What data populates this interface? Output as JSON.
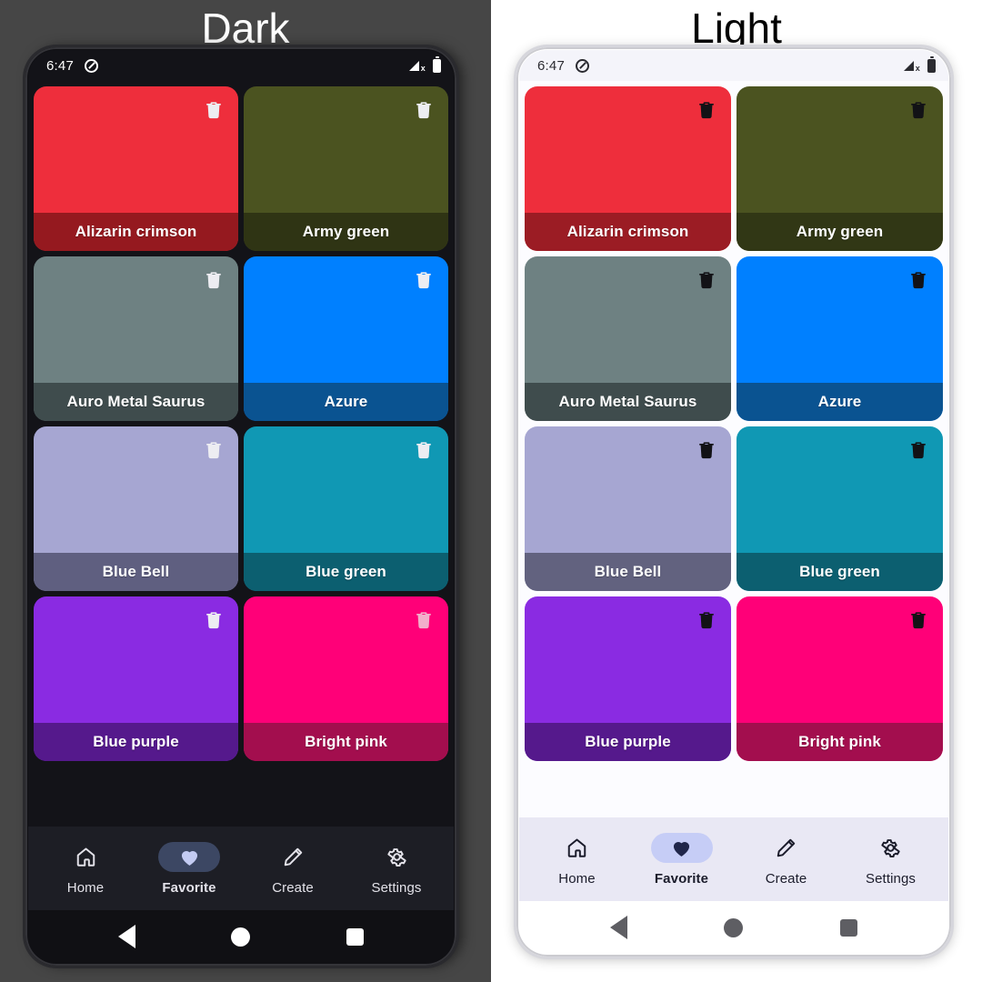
{
  "panels": [
    {
      "title": "Dark",
      "theme": "dark",
      "status_bar": {
        "time": "6:47",
        "dnd_icon": "do-not-disturb-icon",
        "signal_icon": "signal-no-service-icon",
        "battery_icon": "battery-full-icon"
      },
      "cards": [
        {
          "name": "Alizarin crimson",
          "color": "#EE2E3C",
          "footer_color": "#95191F",
          "trash_color": "#EDEDF2"
        },
        {
          "name": "Army green",
          "color": "#4B5320",
          "footer_color": "#2F3414",
          "trash_color": "#EDEDF2"
        },
        {
          "name": "Auro Metal Saurus",
          "color": "#6E8182",
          "footer_color": "#3F4C4D",
          "trash_color": "#EDEDF2"
        },
        {
          "name": "Azure",
          "color": "#0080FF",
          "footer_color": "#0A5391",
          "trash_color": "#EDEDF2"
        },
        {
          "name": "Blue Bell",
          "color": "#A6A6D2",
          "footer_color": "#5F5F80",
          "trash_color": "#EDEDF2"
        },
        {
          "name": "Blue green",
          "color": "#1098B4",
          "footer_color": "#0C5F70",
          "trash_color": "#EDEDF2"
        },
        {
          "name": "Blue purple",
          "color": "#8A2BE2",
          "footer_color": "#55198C",
          "trash_color": "#EDEDF2"
        },
        {
          "name": "Bright pink",
          "color": "#FF0078",
          "footer_color": "#A30E4E",
          "trash_color": "#F2AFCB"
        }
      ],
      "app_nav": [
        {
          "label": "Home",
          "icon": "home-icon",
          "selected": false
        },
        {
          "label": "Favorite",
          "icon": "heart-icon",
          "selected": true
        },
        {
          "label": "Create",
          "icon": "pencil-icon",
          "selected": false
        },
        {
          "label": "Settings",
          "icon": "gear-icon",
          "selected": false
        }
      ],
      "system_nav": [
        {
          "label": "Back",
          "icon": "back-triangle-icon"
        },
        {
          "label": "Home",
          "icon": "home-circle-icon"
        },
        {
          "label": "Recents",
          "icon": "recents-square-icon"
        }
      ]
    },
    {
      "title": "Light",
      "theme": "light",
      "status_bar": {
        "time": "6:47",
        "dnd_icon": "do-not-disturb-icon",
        "signal_icon": "signal-no-service-icon",
        "battery_icon": "battery-full-icon"
      },
      "cards": [
        {
          "name": "Alizarin crimson",
          "color": "#EE2E3C",
          "footer_color": "#9B1C24",
          "trash_color": "#121216"
        },
        {
          "name": "Army green",
          "color": "#4B5320",
          "footer_color": "#313715",
          "trash_color": "#121216"
        },
        {
          "name": "Auro Metal Saurus",
          "color": "#6E8182",
          "footer_color": "#3F4C4D",
          "trash_color": "#121216"
        },
        {
          "name": "Azure",
          "color": "#0080FF",
          "footer_color": "#0A5391",
          "trash_color": "#121216"
        },
        {
          "name": "Blue Bell",
          "color": "#A6A6D2",
          "footer_color": "#62627F",
          "trash_color": "#121216"
        },
        {
          "name": "Blue green",
          "color": "#1098B4",
          "footer_color": "#0C5F70",
          "trash_color": "#121216"
        },
        {
          "name": "Blue purple",
          "color": "#8A2BE2",
          "footer_color": "#55198C",
          "trash_color": "#121216"
        },
        {
          "name": "Bright pink",
          "color": "#FF0078",
          "footer_color": "#A30E4E",
          "trash_color": "#121216"
        }
      ],
      "app_nav": [
        {
          "label": "Home",
          "icon": "home-icon",
          "selected": false
        },
        {
          "label": "Favorite",
          "icon": "heart-icon",
          "selected": true
        },
        {
          "label": "Create",
          "icon": "pencil-icon",
          "selected": false
        },
        {
          "label": "Settings",
          "icon": "gear-icon",
          "selected": false
        }
      ],
      "system_nav": [
        {
          "label": "Back",
          "icon": "back-triangle-icon"
        },
        {
          "label": "Home",
          "icon": "home-circle-icon"
        },
        {
          "label": "Recents",
          "icon": "recents-square-icon"
        }
      ]
    }
  ],
  "icons": {
    "trash": "trash-icon",
    "home": "home-icon",
    "heart": "heart-icon",
    "pencil": "pencil-icon",
    "gear": "gear-icon"
  }
}
